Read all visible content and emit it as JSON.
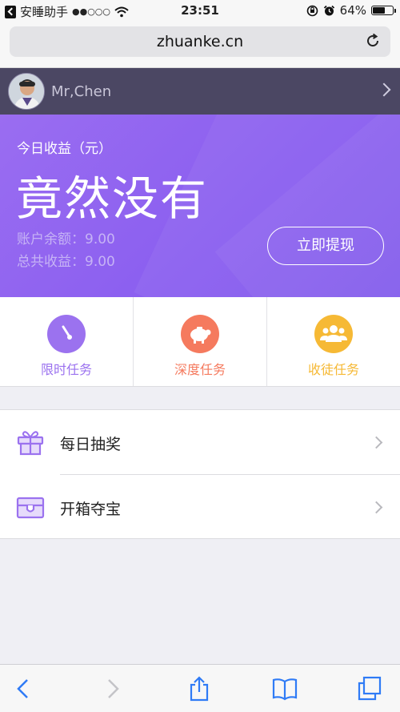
{
  "status_bar": {
    "carrier_app": "安睡助手",
    "signal": "●●○○○",
    "time": "23:51",
    "battery": "64%",
    "battery_level": 0.64
  },
  "browser": {
    "url": "zhuanke.cn"
  },
  "user": {
    "name": "Mr,Chen"
  },
  "earnings": {
    "today_label": "今日收益（元）",
    "today_value": "竟然没有",
    "balance_text": "账户余额：9.00",
    "total_text": "总共收益：9.00",
    "withdraw_label": "立即提现"
  },
  "tasks": [
    {
      "label": "限时任务",
      "icon": "timer-icon",
      "color": "#9b72ef"
    },
    {
      "label": "深度任务",
      "icon": "piggy-bank-icon",
      "color": "#f57a5e"
    },
    {
      "label": "收徒任务",
      "icon": "users-icon",
      "color": "#f6b935"
    }
  ],
  "menu": [
    {
      "label": "每日抽奖",
      "icon": "gift-icon"
    },
    {
      "label": "开箱夺宝",
      "icon": "treasure-chest-icon"
    }
  ],
  "colors": {
    "purple": "#8a5ef0",
    "header_bg": "#4b4763",
    "accent_icon": "#9b72ef"
  }
}
